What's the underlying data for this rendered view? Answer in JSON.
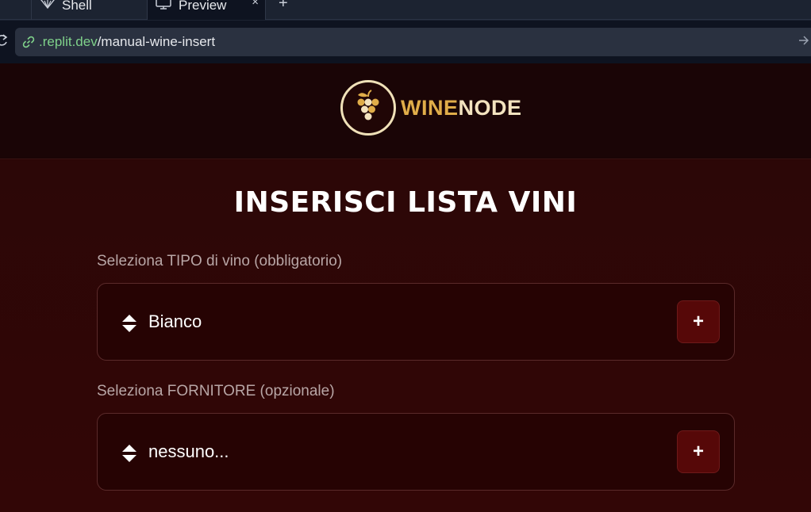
{
  "browser": {
    "tabs": [
      {
        "label": "Shell",
        "icon": "shell-icon"
      },
      {
        "label": "Preview",
        "icon": "monitor-icon",
        "active": true
      }
    ],
    "add_tab_symbol": "+",
    "close_symbol": "×",
    "url_host": ".replit.dev",
    "url_path": "/manual-wine-insert"
  },
  "app": {
    "logo": {
      "part1": "WINE",
      "part2": "NODE",
      "icon": "grapes-icon"
    },
    "title": "INSERISCI LISTA VINI",
    "fields": [
      {
        "label": "Seleziona TIPO di vino (obbligatorio)",
        "value": "Bianco",
        "button": "+"
      },
      {
        "label": "Seleziona FORNITORE (opzionale)",
        "value": "nessuno...",
        "button": "+"
      }
    ],
    "colors": {
      "accent_gold": "#e0ad49",
      "cream": "#f3e3bf",
      "background": "#2a0606",
      "button": "#560808"
    }
  }
}
